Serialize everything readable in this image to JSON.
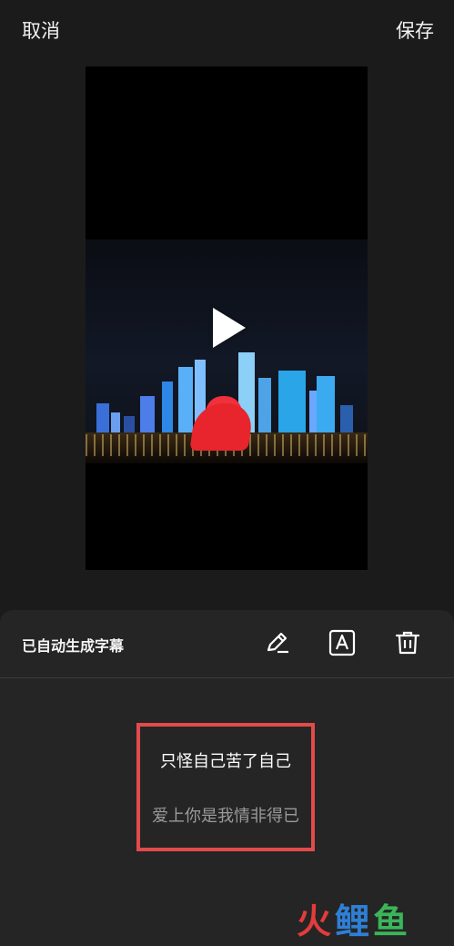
{
  "header": {
    "cancel_label": "取消",
    "save_label": "保存"
  },
  "video": {
    "play_icon": "play-icon"
  },
  "panel": {
    "title": "已自动生成字幕",
    "tools": [
      "edit-icon",
      "text-style-icon",
      "trash-icon"
    ]
  },
  "subtitles": {
    "lines": [
      "只怪自己苦了自己",
      "爱上你是我情非得已"
    ]
  },
  "watermark": {
    "chars": [
      "火",
      "鲤",
      "鱼"
    ]
  },
  "colors": {
    "background": "#1b1b1b",
    "panel": "#252525",
    "highlight_border": "#e34a4a",
    "primary_subtitle": "#ffffff",
    "secondary_subtitle": "#9a9a9a"
  }
}
